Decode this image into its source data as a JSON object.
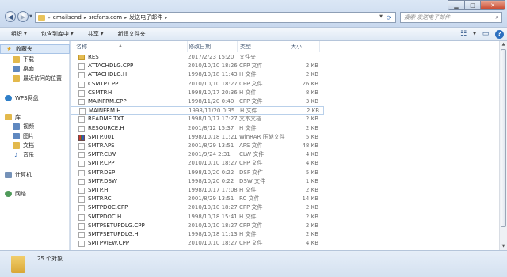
{
  "window": {
    "breadcrumb": [
      "emailsend",
      "srcfans.com",
      "发送电子邮件"
    ],
    "search_placeholder": "搜索 发送电子邮件"
  },
  "toolbar": {
    "items": [
      "组织",
      "包含到库中",
      "共享",
      "新建文件夹"
    ]
  },
  "sidebar": {
    "groups": [
      {
        "label": "收藏夹",
        "icon": "star-icon",
        "items": [
          "下载",
          "桌面",
          "最近访问的位置"
        ]
      },
      {
        "label": "WPS网盘",
        "icon": "cloud-icon",
        "items": []
      },
      {
        "label": "库",
        "icon": "library-icon",
        "items": [
          "视频",
          "图片",
          "文档",
          "音乐"
        ]
      },
      {
        "label": "计算机",
        "icon": "computer-icon",
        "items": []
      },
      {
        "label": "网络",
        "icon": "network-icon",
        "items": []
      }
    ]
  },
  "columns": [
    "名称",
    "修改日期",
    "类型",
    "大小"
  ],
  "files": [
    {
      "name": "RES",
      "date": "2017/2/23 15:20",
      "type": "文件夹",
      "size": "",
      "icon": "folder-icon"
    },
    {
      "name": "ATTACHDLG.CPP",
      "date": "2010/10/10 18:26",
      "type": "CPP 文件",
      "size": "2 KB",
      "icon": "file-icon"
    },
    {
      "name": "ATTACHDLG.H",
      "date": "1998/10/18 11:43",
      "type": "H 文件",
      "size": "2 KB",
      "icon": "file-icon"
    },
    {
      "name": "CSMTP.CPP",
      "date": "2010/10/10 18:27",
      "type": "CPP 文件",
      "size": "26 KB",
      "icon": "file-icon"
    },
    {
      "name": "CSMTP.H",
      "date": "1998/10/17 20:36",
      "type": "H 文件",
      "size": "8 KB",
      "icon": "file-icon"
    },
    {
      "name": "MAINFRM.CPP",
      "date": "1998/11/20 0:40",
      "type": "CPP 文件",
      "size": "3 KB",
      "icon": "file-icon"
    },
    {
      "name": "MAINFRM.H",
      "date": "1998/11/20 0:35",
      "type": "H 文件",
      "size": "2 KB",
      "icon": "file-icon"
    },
    {
      "name": "README.TXT",
      "date": "1998/10/17 17:27",
      "type": "文本文档",
      "size": "2 KB",
      "icon": "file-icon"
    },
    {
      "name": "RESOURCE.H",
      "date": "2001/8/12 15:37",
      "type": "H 文件",
      "size": "2 KB",
      "icon": "file-icon"
    },
    {
      "name": "SMTP.001",
      "date": "1998/10/18 11:21",
      "type": "WinRAR 压缩文件",
      "size": "5 KB",
      "icon": "rar-icon"
    },
    {
      "name": "SMTP.APS",
      "date": "2001/8/29 13:51",
      "type": "APS 文件",
      "size": "48 KB",
      "icon": "file-icon"
    },
    {
      "name": "SMTP.CLW",
      "date": "2001/9/24 2:31",
      "type": "CLW 文件",
      "size": "4 KB",
      "icon": "file-icon"
    },
    {
      "name": "SMTP.CPP",
      "date": "2010/10/10 18:27",
      "type": "CPP 文件",
      "size": "4 KB",
      "icon": "file-icon"
    },
    {
      "name": "SMTP.DSP",
      "date": "1998/10/20 0:22",
      "type": "DSP 文件",
      "size": "5 KB",
      "icon": "file-icon"
    },
    {
      "name": "SMTP.DSW",
      "date": "1998/10/20 0:22",
      "type": "DSW 文件",
      "size": "1 KB",
      "icon": "file-icon"
    },
    {
      "name": "SMTP.H",
      "date": "1998/10/17 17:08",
      "type": "H 文件",
      "size": "2 KB",
      "icon": "file-icon"
    },
    {
      "name": "SMTP.RC",
      "date": "2001/8/29 13:51",
      "type": "RC 文件",
      "size": "14 KB",
      "icon": "file-icon"
    },
    {
      "name": "SMTPDOC.CPP",
      "date": "2010/10/10 18:27",
      "type": "CPP 文件",
      "size": "2 KB",
      "icon": "file-icon"
    },
    {
      "name": "SMTPDOC.H",
      "date": "1998/10/18 15:41",
      "type": "H 文件",
      "size": "2 KB",
      "icon": "file-icon"
    },
    {
      "name": "SMTPSETUPDLG.CPP",
      "date": "2010/10/10 18:27",
      "type": "CPP 文件",
      "size": "2 KB",
      "icon": "file-icon"
    },
    {
      "name": "SMTPSETUPDLG.H",
      "date": "1998/10/18 11:13",
      "type": "H 文件",
      "size": "2 KB",
      "icon": "file-icon"
    },
    {
      "name": "SMTPVIEW.CPP",
      "date": "2010/10/10 18:27",
      "type": "CPP 文件",
      "size": "4 KB",
      "icon": "file-icon"
    }
  ],
  "selected_file": "MAINFRM.H",
  "status": {
    "count_text": "25 个对象"
  }
}
